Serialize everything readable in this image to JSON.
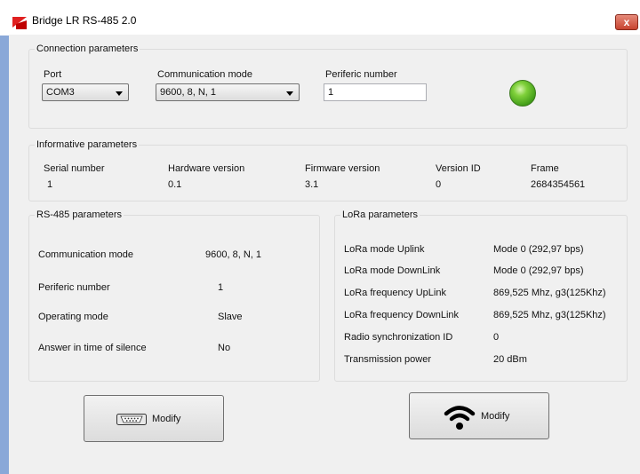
{
  "window": {
    "title": "Bridge LR RS-485 2.0",
    "close_label": "x"
  },
  "connection": {
    "legend": "Connection parameters",
    "port_label": "Port",
    "port_value": "COM3",
    "mode_label": "Communication mode",
    "mode_value": "9600, 8, N, 1",
    "periferic_label": "Periferic number",
    "periferic_value": "1",
    "status_color": "#5cbf23"
  },
  "info": {
    "legend": "Informative parameters",
    "columns": [
      {
        "label": "Serial number",
        "value": "1"
      },
      {
        "label": "Hardware version",
        "value": "0.1"
      },
      {
        "label": "Firmware version",
        "value": "3.1"
      },
      {
        "label": "Version ID",
        "value": "0"
      },
      {
        "label": "Frame",
        "value": "2684354561"
      }
    ]
  },
  "rs485": {
    "legend": "RS-485 parameters",
    "rows": [
      {
        "label": "Communication mode",
        "value": "9600, 8, N, 1"
      },
      {
        "label": "Periferic number",
        "value": "1"
      },
      {
        "label": "Operating mode",
        "value": "Slave"
      },
      {
        "label": "Answer in time of silence",
        "value": "No"
      }
    ],
    "modify_label": "Modify"
  },
  "lora": {
    "legend": "LoRa parameters",
    "rows": [
      {
        "label": "LoRa mode Uplink",
        "value": "Mode 0 (292,97 bps)"
      },
      {
        "label": "LoRa mode DownLink",
        "value": "Mode 0 (292,97 bps)"
      },
      {
        "label": "LoRa frequency UpLink",
        "value": "869,525 Mhz, g3(125Khz)"
      },
      {
        "label": "LoRa frequency DownLink",
        "value": "869,525 Mhz, g3(125Khz)"
      },
      {
        "label": "Radio synchronization ID",
        "value": "0"
      },
      {
        "label": "Transmission power",
        "value": "20 dBm"
      }
    ],
    "modify_label": "Modify"
  }
}
